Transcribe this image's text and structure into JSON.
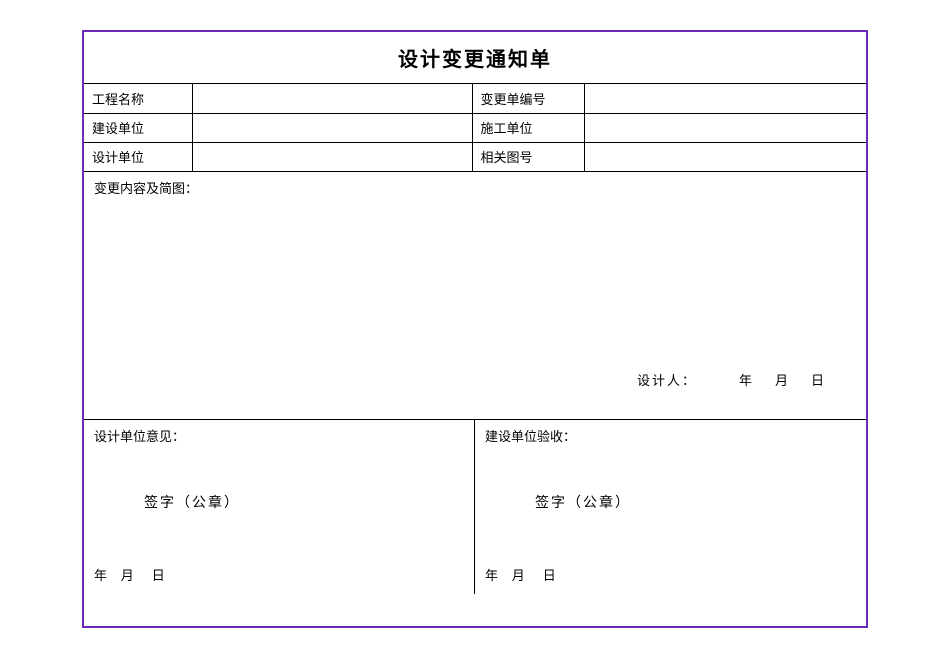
{
  "title": "设计变更通知单",
  "meta": {
    "row1": {
      "labelA": "工程名称",
      "valA": "",
      "labelB": "变更单编号",
      "valB": ""
    },
    "row2": {
      "labelA": "建设单位",
      "valA": "",
      "labelB": "施工单位",
      "valB": ""
    },
    "row3": {
      "labelA": "设计单位",
      "valA": "",
      "labelB": "相关图号",
      "valB": ""
    }
  },
  "content": {
    "heading": "变更内容及简图：",
    "designer_line": "设计人：        年    月    日"
  },
  "approval": {
    "left": {
      "heading": "设计单位意见：",
      "signature": "签字（公章）",
      "date": "年   月    日"
    },
    "right": {
      "heading": "建设单位验收：",
      "signature": "签字（公章）",
      "date": "年   月    日"
    }
  }
}
